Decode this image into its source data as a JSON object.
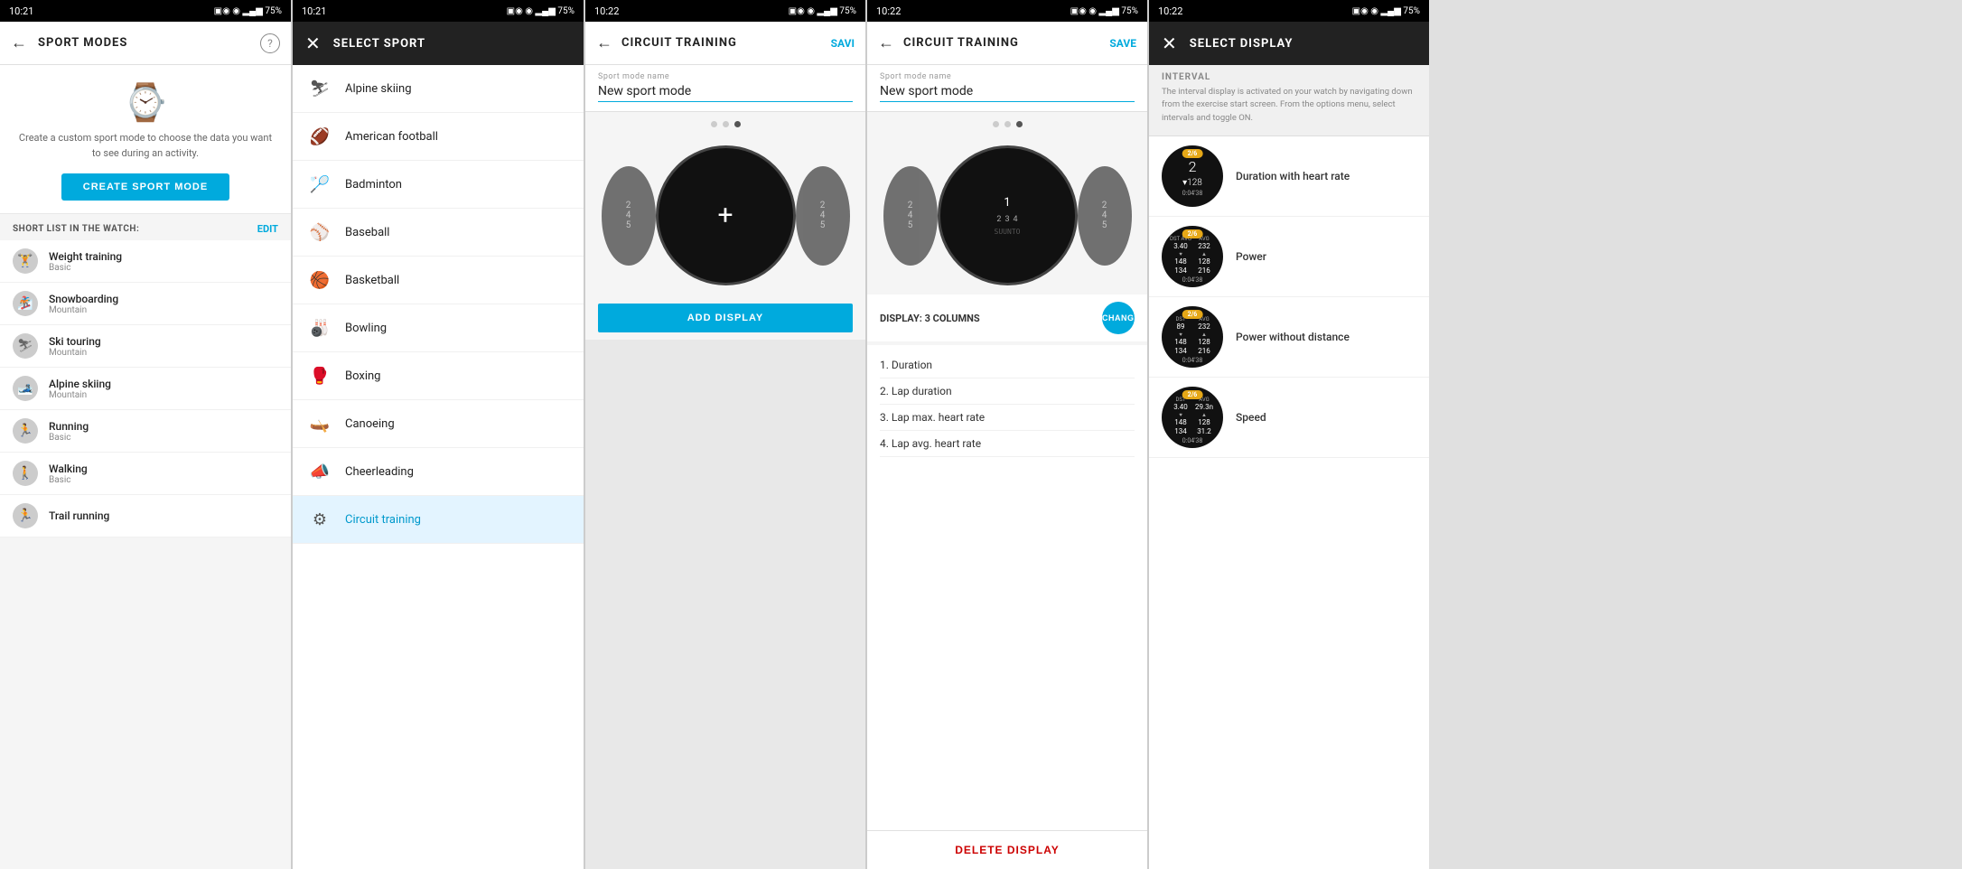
{
  "panel1": {
    "status": {
      "time": "10:21",
      "battery": "75%"
    },
    "topBar": {
      "title": "SPORT MODES",
      "helpLabel": "?"
    },
    "hero": {
      "description": "Create a custom sport mode to choose the data you want to see during an activity.",
      "createBtn": "CREATE SPORT MODE"
    },
    "shortList": {
      "label": "SHORT LIST IN THE WATCH:",
      "editBtn": "EDIT"
    },
    "items": [
      {
        "name": "Weight training",
        "sub": "Basic",
        "icon": "🏋"
      },
      {
        "name": "Snowboarding",
        "sub": "Mountain",
        "icon": "🏂"
      },
      {
        "name": "Ski touring",
        "sub": "Mountain",
        "icon": "⛷"
      },
      {
        "name": "Alpine skiing",
        "sub": "Mountain",
        "icon": "🎿"
      },
      {
        "name": "Running",
        "sub": "Basic",
        "icon": "🏃"
      },
      {
        "name": "Walking",
        "sub": "Basic",
        "icon": "🚶"
      },
      {
        "name": "Trail running",
        "sub": "",
        "icon": "🏃"
      }
    ]
  },
  "panel2": {
    "status": {
      "time": "10:21",
      "battery": "75%"
    },
    "topBar": {
      "title": "SELECT SPORT"
    },
    "sports": [
      {
        "name": "Alpine skiing",
        "icon": "⛷"
      },
      {
        "name": "American football",
        "icon": "🏈"
      },
      {
        "name": "Badminton",
        "icon": "🏸"
      },
      {
        "name": "Baseball",
        "icon": "⚾"
      },
      {
        "name": "Basketball",
        "icon": "🏀"
      },
      {
        "name": "Bowling",
        "icon": "🎳"
      },
      {
        "name": "Boxing",
        "icon": "🥊"
      },
      {
        "name": "Canoeing",
        "icon": "🛶"
      },
      {
        "name": "Cheerleading",
        "icon": "📣"
      },
      {
        "name": "Circuit training",
        "icon": "⚙",
        "highlighted": true
      }
    ]
  },
  "panel3": {
    "status": {
      "time": "10:22",
      "battery": "75%"
    },
    "topBar": {
      "title": "CIRCUIT TRAINING",
      "saveBtn": "SAVI"
    },
    "sportNameLabel": "Sport mode name",
    "sportNameValue": "New sport mode",
    "dots": [
      false,
      false,
      true
    ],
    "addDisplayBtn": "ADD DISPLAY",
    "watchLeft": {
      "lines": [
        "2",
        "4",
        "5"
      ]
    },
    "watchRight": {
      "lines": [
        "2",
        "4",
        "5"
      ]
    }
  },
  "panel4": {
    "status": {
      "time": "10:22",
      "battery": "75%"
    },
    "topBar": {
      "title": "CIRCUIT TRAINING",
      "saveBtn": "SAVE"
    },
    "sportNameLabel": "Sport mode name",
    "sportNameValue": "New sport mode",
    "dots": [
      false,
      false,
      true
    ],
    "displayLabel": "DISPLAY: 3 COLUMNS",
    "changeBtn": "CHANGE",
    "displayItems": [
      "1. Duration",
      "2. Lap duration",
      "3. Lap max. heart rate",
      "4. Lap avg. heart rate"
    ],
    "deleteBtn": "DELETE DISPLAY"
  },
  "panel5": {
    "status": {
      "time": "10:22",
      "battery": "75%"
    },
    "topBar": {
      "title": "SELECT DISPLAY"
    },
    "interval": {
      "label": "INTERVAL",
      "description": "The interval display is activated on your watch by navigating down from the exercise start screen. From the options menu, select intervals and toggle ON."
    },
    "options": [
      {
        "label": "Duration with heart rate",
        "badge": "2/6",
        "type": "duration-hr",
        "bigNum": "2",
        "subVal": "128",
        "timeVal": "0:04'38",
        "accentColor": "#e6a817"
      },
      {
        "label": "Power",
        "badge": "2/6",
        "type": "power-grid",
        "accentColor": "#e6a817",
        "gridData": [
          {
            "top": "3.40",
            "bot": "148"
          },
          {
            "top": "232",
            "bot": "128"
          },
          {
            "top": "134",
            "bot": "216"
          }
        ],
        "timeVal": "0:04'38"
      },
      {
        "label": "Power without distance",
        "badge": "2/6",
        "type": "power-nodist",
        "accentColor": "#e6a817",
        "gridData": [
          {
            "top": "89",
            "bot": "148"
          },
          {
            "top": "232",
            "bot": "128"
          },
          {
            "top": "134",
            "bot": "216"
          }
        ],
        "timeVal": "0:04'38"
      },
      {
        "label": "Speed",
        "badge": "2/6",
        "type": "speed-grid",
        "accentColor": "#e6a817",
        "gridData": [
          {
            "top": "3.40",
            "bot": "148"
          },
          {
            "top": "29.3n",
            "bot": "128"
          },
          {
            "top": "134",
            "bot": "31.2"
          }
        ],
        "timeVal": "0:04'38"
      }
    ]
  }
}
